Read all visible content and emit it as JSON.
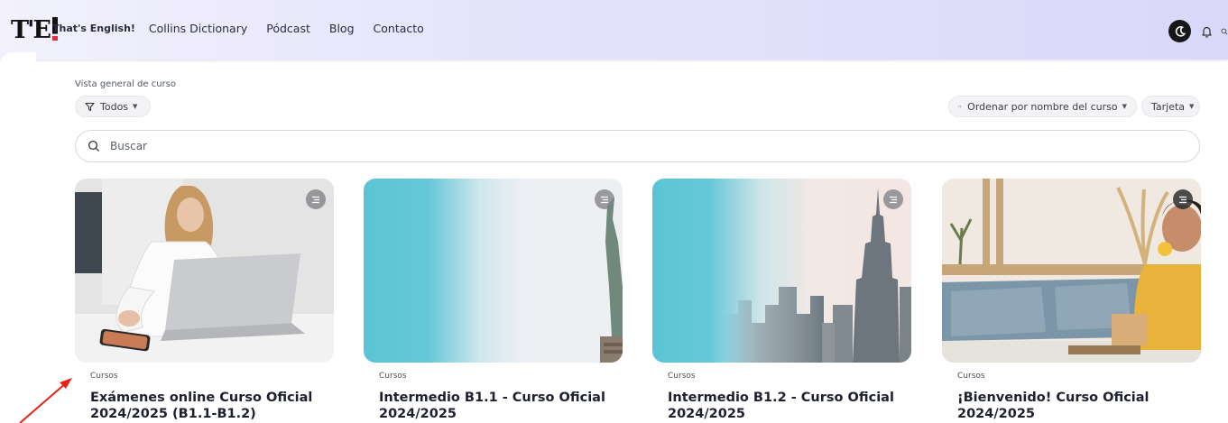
{
  "nav": {
    "logo_text": "T'E",
    "brand_link": "That's English!",
    "links": [
      "Collins Dictionary",
      "Pódcast",
      "Blog",
      "Contacto"
    ]
  },
  "overview": {
    "section_title": "Vista general de curso",
    "filter_label": "Todos",
    "sort_label": "Ordenar por nombre del curso",
    "view_label": "Tarjeta",
    "search_placeholder": "Buscar"
  },
  "courses": [
    {
      "category": "Cursos",
      "title": "Exámenes online Curso Oficial 2024/2025 (B1.1-B1.2)"
    },
    {
      "category": "Cursos",
      "title": "Intermedio B1.1 - Curso Oficial 2024/2025"
    },
    {
      "category": "Cursos",
      "title": "Intermedio B1.2 - Curso Oficial 2024/2025"
    },
    {
      "category": "Cursos",
      "title": "¡Bienvenido! Curso Oficial 2024/2025"
    }
  ],
  "colors": {
    "nav_bg": "#e6e4fb",
    "accent_teal": "#5bc4d4",
    "annotation_arrow": "#e5231b"
  },
  "icons": [
    "filter-icon",
    "sort-icon",
    "search-icon",
    "theme-toggle-icon",
    "bell-icon",
    "search-nav-icon",
    "card-menu-icon"
  ]
}
